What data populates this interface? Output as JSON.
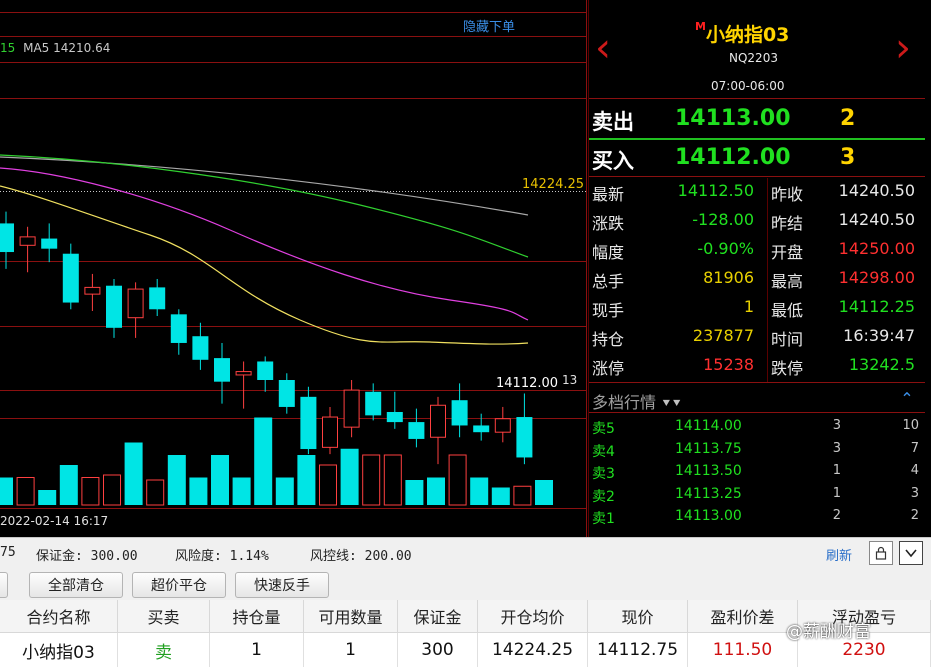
{
  "chart": {
    "hide_link": "隐藏下单",
    "ma_prefix": "15",
    "ma_label": "MA5 14210.64",
    "price_marker_high": "14224.25",
    "price_marker_last": "14112.00",
    "price_marker_suffix": "13",
    "date_label": "2022-02-14 16:17",
    "candles": [
      {
        "o": 14205,
        "c": 14188,
        "h": 14212,
        "l": 14178
      },
      {
        "o": 14192,
        "c": 14197,
        "h": 14203,
        "l": 14176
      },
      {
        "o": 14196,
        "c": 14190,
        "h": 14205,
        "l": 14182
      },
      {
        "o": 14187,
        "c": 14158,
        "h": 14193,
        "l": 14154
      },
      {
        "o": 14163,
        "c": 14167,
        "h": 14175,
        "l": 14153
      },
      {
        "o": 14168,
        "c": 14143,
        "h": 14172,
        "l": 14137
      },
      {
        "o": 14149,
        "c": 14166,
        "h": 14170,
        "l": 14137
      },
      {
        "o": 14167,
        "c": 14154,
        "h": 14172,
        "l": 14150
      },
      {
        "o": 14151,
        "c": 14134,
        "h": 14154,
        "l": 14127
      },
      {
        "o": 14138,
        "c": 14124,
        "h": 14146,
        "l": 14118
      },
      {
        "o": 14125,
        "c": 14111,
        "h": 14134,
        "l": 14098
      },
      {
        "o": 14115,
        "c": 14117,
        "h": 14123,
        "l": 14095
      },
      {
        "o": 14123,
        "c": 14112,
        "h": 14126,
        "l": 14105
      },
      {
        "o": 14112,
        "c": 14096,
        "h": 14116,
        "l": 14092
      },
      {
        "o": 14102,
        "c": 14071,
        "h": 14108,
        "l": 14068
      },
      {
        "o": 14072,
        "c": 14090,
        "h": 14096,
        "l": 14068
      },
      {
        "o": 14084,
        "c": 14106,
        "h": 14112,
        "l": 14078
      },
      {
        "o": 14105,
        "c": 14091,
        "h": 14110,
        "l": 14088
      },
      {
        "o": 14093,
        "c": 14087,
        "h": 14105,
        "l": 14083
      },
      {
        "o": 14087,
        "c": 14077,
        "h": 14095,
        "l": 14072
      },
      {
        "o": 14078,
        "c": 14097,
        "h": 14102,
        "l": 14062
      },
      {
        "o": 14100,
        "c": 14085,
        "h": 14110,
        "l": 14078
      },
      {
        "o": 14085,
        "c": 14081,
        "h": 14092,
        "l": 14076
      },
      {
        "o": 14081,
        "c": 14089,
        "h": 14096,
        "l": 14075
      },
      {
        "o": 14090,
        "c": 14066,
        "h": 14104,
        "l": 14062
      }
    ],
    "volumes": [
      {
        "v": 22,
        "up": false
      },
      {
        "v": 22,
        "up": true
      },
      {
        "v": 12,
        "up": false
      },
      {
        "v": 32,
        "up": false
      },
      {
        "v": 22,
        "up": true
      },
      {
        "v": 24,
        "up": true
      },
      {
        "v": 50,
        "up": false
      },
      {
        "v": 20,
        "up": true
      },
      {
        "v": 40,
        "up": false
      },
      {
        "v": 22,
        "up": false
      },
      {
        "v": 40,
        "up": false
      },
      {
        "v": 22,
        "up": false
      },
      {
        "v": 70,
        "up": false
      },
      {
        "v": 22,
        "up": false
      },
      {
        "v": 40,
        "up": false
      },
      {
        "v": 32,
        "up": true
      },
      {
        "v": 45,
        "up": false
      },
      {
        "v": 40,
        "up": true
      },
      {
        "v": 40,
        "up": true
      },
      {
        "v": 20,
        "up": false
      },
      {
        "v": 22,
        "up": false
      },
      {
        "v": 40,
        "up": true
      },
      {
        "v": 22,
        "up": false
      },
      {
        "v": 14,
        "up": false
      },
      {
        "v": 15,
        "up": true
      },
      {
        "v": 20,
        "up": false
      }
    ],
    "colors": {
      "up": "#ff4040",
      "down": "#00e5e5",
      "ma5": "#f0e060",
      "ma10": "#e040e0",
      "ma20": "#30d030",
      "ma60": "#a8a8a8"
    }
  },
  "quote": {
    "m_mark": "M",
    "title": "小纳指03",
    "code": "NQ2203",
    "session": "07:00-06:00",
    "sell_label": "卖出",
    "sell_price": "14113.00",
    "sell_qty": "2",
    "buy_label": "买入",
    "buy_price": "14112.00",
    "buy_qty": "3",
    "rows": [
      {
        "l1": "最新",
        "v1": "14112.50",
        "c1": "green",
        "l2": "昨收",
        "v2": "14240.50",
        "c2": "white"
      },
      {
        "l1": "涨跌",
        "v1": "-128.00",
        "c1": "green",
        "l2": "昨结",
        "v2": "14240.50",
        "c2": "white"
      },
      {
        "l1": "幅度",
        "v1": "-0.90%",
        "c1": "green",
        "l2": "开盘",
        "v2": "14250.00",
        "c2": "red"
      },
      {
        "l1": "总手",
        "v1": "81906",
        "c1": "yellow",
        "l2": "最高",
        "v2": "14298.00",
        "c2": "red"
      },
      {
        "l1": "现手",
        "v1": "1",
        "c1": "yellow",
        "l2": "最低",
        "v2": "14112.25",
        "c2": "green"
      },
      {
        "l1": "持仓",
        "v1": "237877",
        "c1": "yellow",
        "l2": "时间",
        "v2": "16:39:47",
        "c2": "white"
      },
      {
        "l1": "涨停",
        "v1": "15238",
        "c1": "red",
        "l2": "跌停",
        "v2": "13242.5",
        "c2": "green"
      }
    ],
    "depth_title": "多档行情",
    "depth": [
      {
        "lbl": "卖5",
        "price": "14114.00",
        "v1": "3",
        "v2": "10"
      },
      {
        "lbl": "卖4",
        "price": "14113.75",
        "v1": "3",
        "v2": "7"
      },
      {
        "lbl": "卖3",
        "price": "14113.50",
        "v1": "1",
        "v2": "4"
      },
      {
        "lbl": "卖2",
        "price": "14113.25",
        "v1": "1",
        "v2": "3"
      },
      {
        "lbl": "卖1",
        "price": "14113.00",
        "v1": "2",
        "v2": "2"
      }
    ]
  },
  "info": {
    "partial": "75",
    "margin": "保证金: 300.00",
    "risk": "风险度: 1.14%",
    "riskline": "风控线: 200.00",
    "refresh": "刷新"
  },
  "buttons": [
    "全部清仓",
    "超价平仓",
    "快速反手"
  ],
  "table": {
    "headers": [
      "合约名称",
      "买卖",
      "持仓量",
      "可用数量",
      "保证金",
      "开仓均价",
      "现价",
      "盈利价差",
      "浮动盈亏"
    ],
    "row": [
      "小纳指03",
      "卖",
      "1",
      "1",
      "300",
      "14224.25",
      "14112.75",
      "111.50",
      "2230"
    ]
  },
  "watermark": "@薪酬财富"
}
